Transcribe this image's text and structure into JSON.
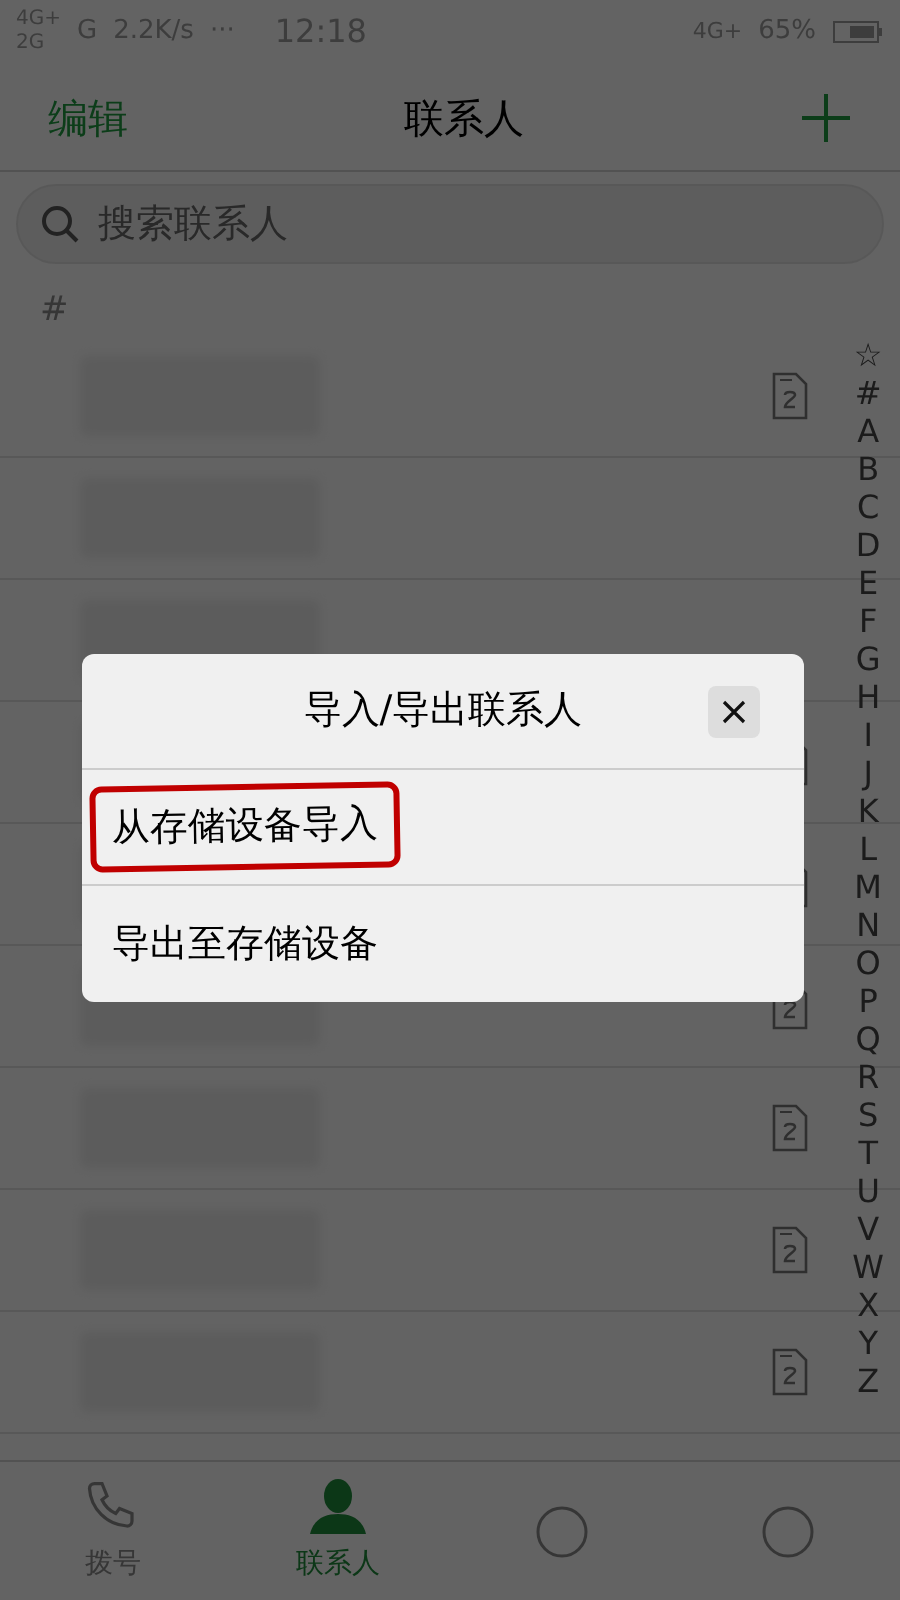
{
  "status_bar": {
    "network_1": "4G+",
    "network_2": "2G",
    "network_3": "G",
    "speed": "2.2K/s",
    "more": "···",
    "time": "12:18",
    "network_4": "4G+",
    "battery": "65%"
  },
  "header": {
    "left": "编辑",
    "title": "联系人"
  },
  "search": {
    "placeholder": "搜索联系人"
  },
  "list": [
    {
      "kind": "section",
      "label": "#"
    },
    {
      "kind": "contact",
      "sim": true
    },
    {
      "kind": "contact",
      "sim": false
    },
    {
      "kind": "contact",
      "sim": false
    },
    {
      "kind": "contact",
      "sim": true
    },
    {
      "kind": "contact",
      "sim": true
    },
    {
      "kind": "contact",
      "sim": true
    },
    {
      "kind": "contact",
      "sim": true
    },
    {
      "kind": "contact",
      "sim": true
    },
    {
      "kind": "contact",
      "sim": true
    }
  ],
  "index": [
    "☆",
    "#",
    "A",
    "B",
    "C",
    "D",
    "E",
    "F",
    "G",
    "H",
    "I",
    "J",
    "K",
    "L",
    "M",
    "N",
    "O",
    "P",
    "Q",
    "R",
    "S",
    "T",
    "U",
    "V",
    "W",
    "X",
    "Y",
    "Z"
  ],
  "bottom_nav": [
    {
      "kind": "phone",
      "label": "拨号",
      "selected": false
    },
    {
      "kind": "person",
      "label": "联系人",
      "selected": true
    },
    {
      "kind": "other",
      "selected": false
    },
    {
      "kind": "other",
      "selected": false
    }
  ],
  "dialog": {
    "title": "导入/导出联系人",
    "options": [
      {
        "label": "从存储设备导入",
        "highlighted": true
      },
      {
        "label": "导出至存储设备",
        "highlighted": false
      }
    ]
  }
}
